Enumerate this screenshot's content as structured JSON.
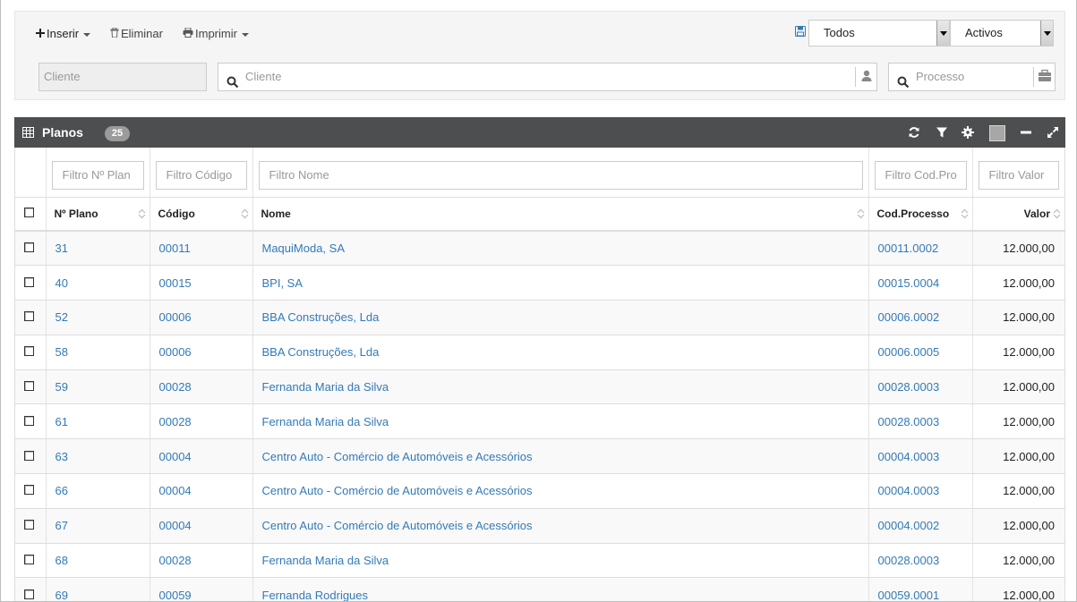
{
  "toolbar": {
    "insert_label": "Inserir",
    "delete_label": "Eliminar",
    "print_label": "Imprimir",
    "filter_select_value": "Todos",
    "status_select_value": "Activos",
    "client_code_placeholder": "Cliente",
    "client_search_placeholder": "Cliente",
    "process_placeholder": "Processo"
  },
  "panel": {
    "title": "Planos",
    "count": "25"
  },
  "table": {
    "filters": [
      "Filtro Nº Plan",
      "Filtro Código",
      "Filtro Nome",
      "Filtro Cod.Pro",
      "Filtro Valor"
    ],
    "columns": [
      "Nº Plano",
      "Código",
      "Nome",
      "Cod.Processo",
      "Valor"
    ],
    "rows": [
      [
        "31",
        "00011",
        "MaquiModa, SA",
        "00011.0002",
        "12.000,00"
      ],
      [
        "40",
        "00015",
        "BPI, SA",
        "00015.0004",
        "12.000,00"
      ],
      [
        "52",
        "00006",
        "BBA Construções, Lda",
        "00006.0002",
        "12.000,00"
      ],
      [
        "58",
        "00006",
        "BBA Construções, Lda",
        "00006.0005",
        "12.000,00"
      ],
      [
        "59",
        "00028",
        "Fernanda Maria da Silva",
        "00028.0003",
        "12.000,00"
      ],
      [
        "61",
        "00028",
        "Fernanda Maria da Silva",
        "00028.0003",
        "12.000,00"
      ],
      [
        "63",
        "00004",
        "Centro Auto - Comércio de Automóveis e Acessórios",
        "00004.0003",
        "12.000,00"
      ],
      [
        "66",
        "00004",
        "Centro Auto - Comércio de Automóveis e Acessórios",
        "00004.0003",
        "12.000,00"
      ],
      [
        "67",
        "00004",
        "Centro Auto - Comércio de Automóveis e Acessórios",
        "00004.0002",
        "12.000,00"
      ],
      [
        "68",
        "00028",
        "Fernanda Maria da Silva",
        "00028.0003",
        "12.000,00"
      ],
      [
        "69",
        "00059",
        "Fernanda Rodrigues",
        "00059.0001",
        "12.000,00"
      ]
    ]
  },
  "icons": {
    "insert": "plus-icon",
    "delete": "trash-icon",
    "print": "printer-icon",
    "save": "floppy-icon",
    "search": "search-icon",
    "user": "user-icon",
    "briefcase": "briefcase-icon",
    "grid": "table-icon",
    "refresh": "refresh-icon",
    "filter": "funnel-icon",
    "settings": "gear-icon",
    "minimize": "minus-icon",
    "expand": "expand-icon"
  },
  "colors": {
    "link": "#337ab7",
    "header_bar": "#4d4e50",
    "badge": "#9b9b9b"
  }
}
